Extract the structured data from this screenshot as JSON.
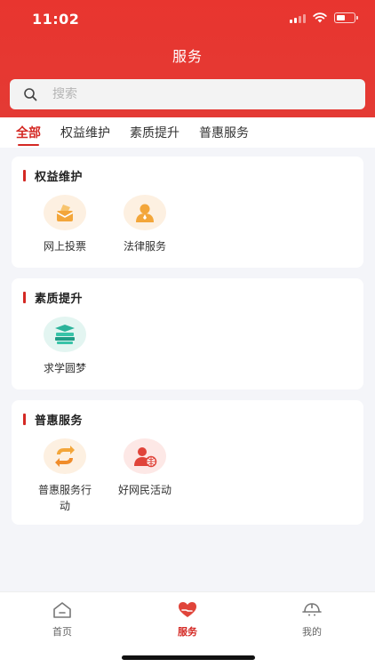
{
  "status": {
    "time": "11:02"
  },
  "header": {
    "title": "服务"
  },
  "search": {
    "placeholder": "搜索"
  },
  "tabs": [
    {
      "label": "全部",
      "active": true
    },
    {
      "label": "权益维护",
      "active": false
    },
    {
      "label": "素质提升",
      "active": false
    },
    {
      "label": "普惠服务",
      "active": false
    }
  ],
  "sections": [
    {
      "title": "权益维护",
      "items": [
        {
          "label": "网上投票",
          "icon": "ballot-icon"
        },
        {
          "label": "法律服务",
          "icon": "lawyer-icon"
        }
      ]
    },
    {
      "title": "素质提升",
      "items": [
        {
          "label": "求学圆梦",
          "icon": "books-icon"
        }
      ]
    },
    {
      "title": "普惠服务",
      "items": [
        {
          "label": "普惠服务行动",
          "icon": "exchange-icon"
        },
        {
          "label": "好网民活动",
          "icon": "netizen-icon"
        }
      ]
    }
  ],
  "tabbar": {
    "items": [
      {
        "label": "首页",
        "icon": "home-icon",
        "active": false
      },
      {
        "label": "服务",
        "icon": "heart-hand-icon",
        "active": true
      },
      {
        "label": "我的",
        "icon": "helmet-icon",
        "active": false
      }
    ]
  },
  "colors": {
    "brand_red": "#e8352f",
    "active_red": "#d42924",
    "background": "#f4f5f9"
  }
}
